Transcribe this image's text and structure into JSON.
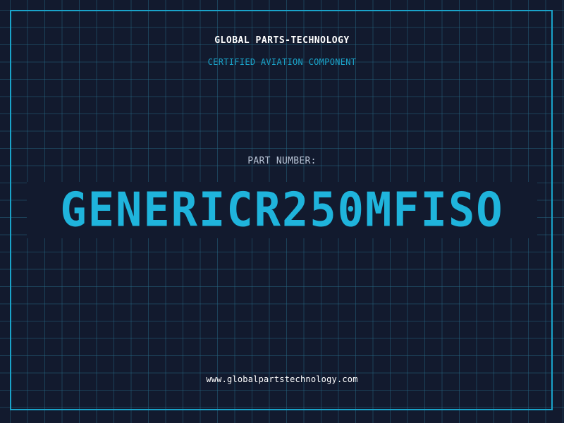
{
  "header": {
    "company_name": "GLOBAL PARTS-TECHNOLOGY",
    "tagline": "CERTIFIED AVIATION COMPONENT"
  },
  "part": {
    "label": "PART NUMBER:",
    "number": "GENERICR250MFISO"
  },
  "footer": {
    "website": "www.globalpartstechnology.com"
  },
  "colors": {
    "background": "#121a2e",
    "accent": "#1aa3c9",
    "part_number": "#1fb4dc",
    "grid": "#286e8c"
  }
}
